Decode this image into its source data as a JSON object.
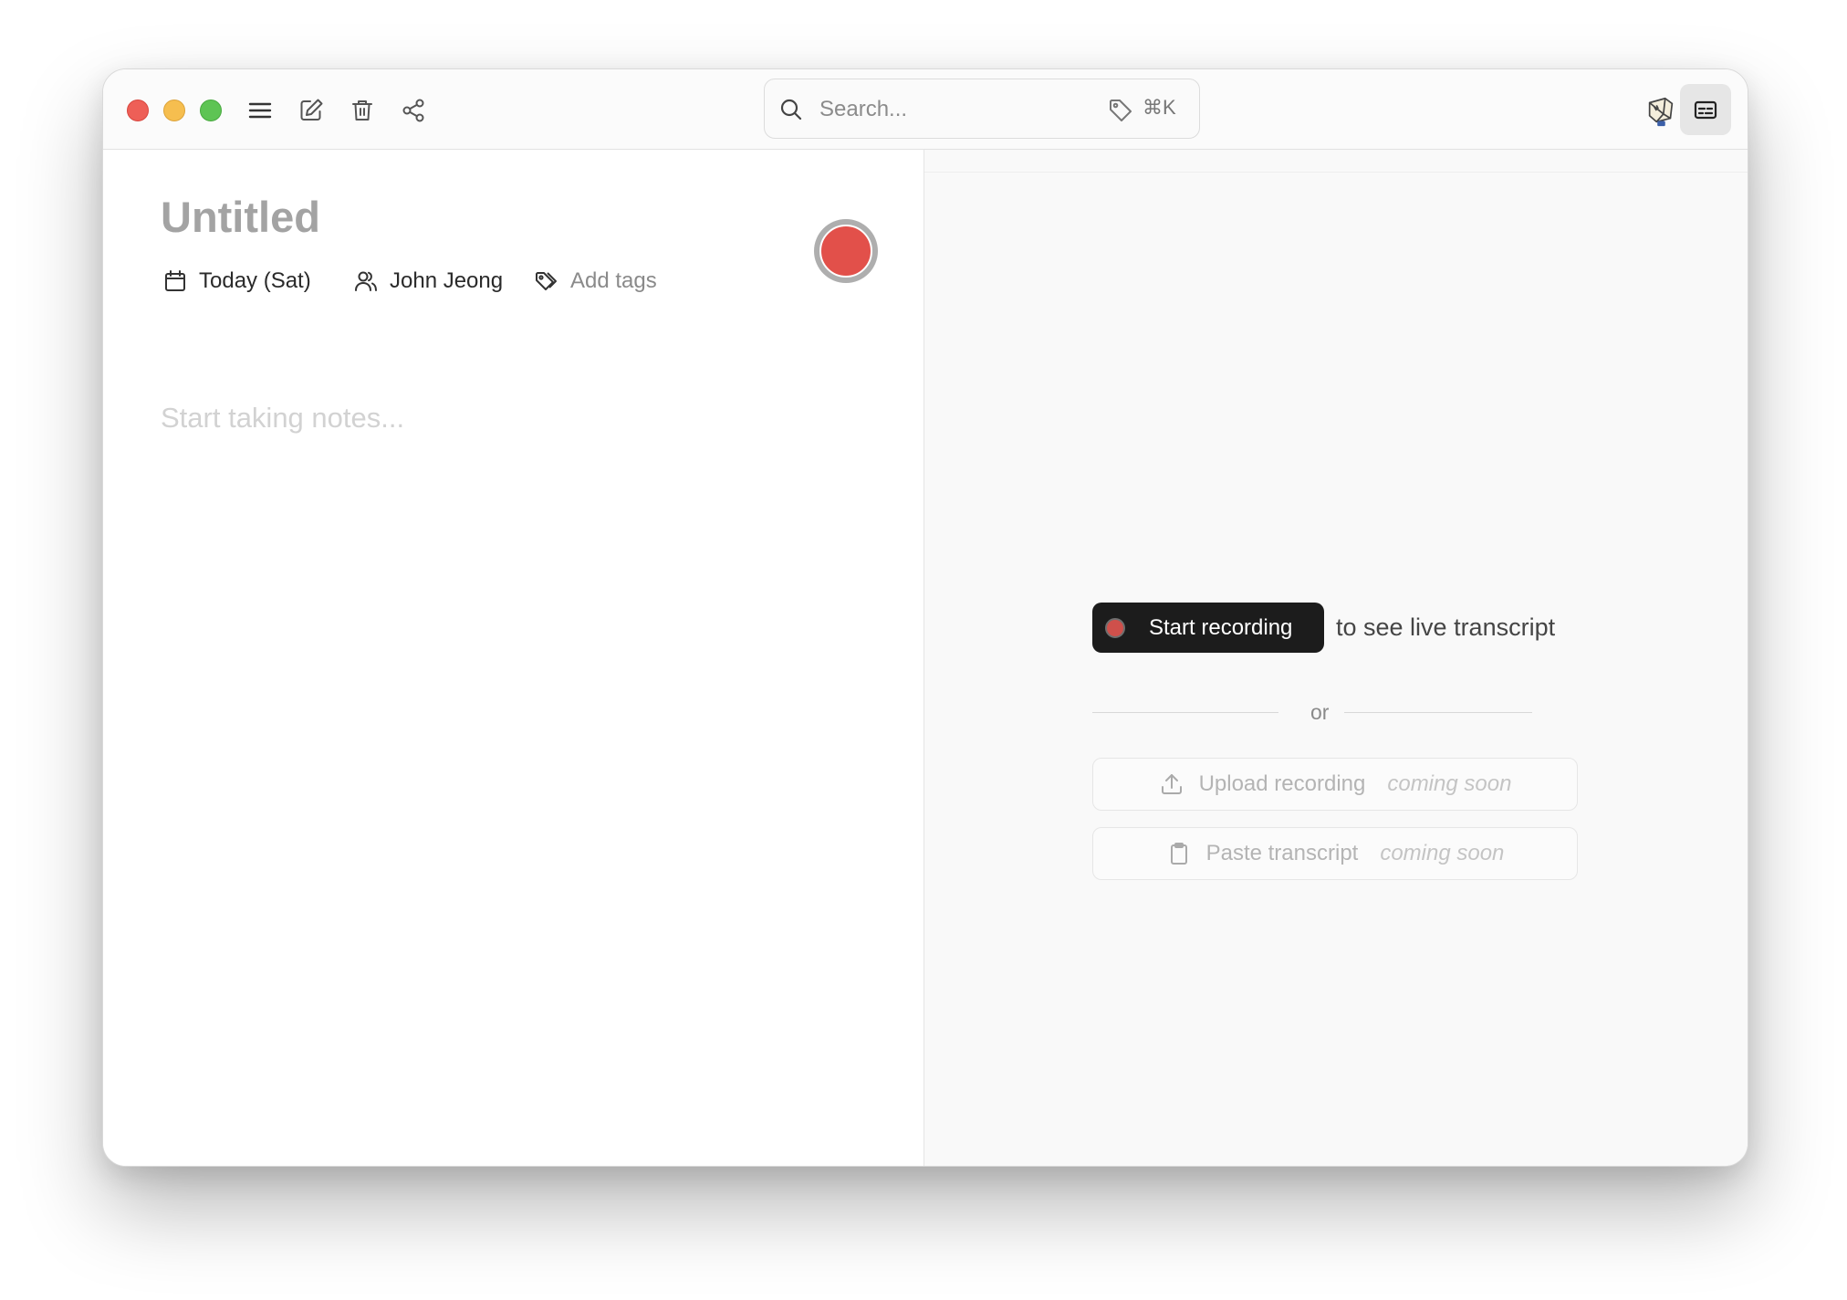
{
  "toolbar": {
    "menu_icon": "hamburger-menu-icon",
    "new_note_icon": "compose-icon",
    "delete_icon": "trash-icon",
    "share_icon": "share-icon"
  },
  "search": {
    "placeholder": "Search...",
    "shortcut": "⌘K"
  },
  "note": {
    "title": "Untitled",
    "date": "Today (Sat)",
    "author": "John Jeong",
    "tags_placeholder": "Add tags",
    "body_placeholder": "Start taking notes..."
  },
  "transcript": {
    "start_button": "Start recording",
    "live_text": "to see live transcript",
    "or": "or",
    "upload_label": "Upload recording",
    "upload_soon": "coming soon",
    "paste_label": "Paste transcript",
    "paste_soon": "coming soon"
  },
  "colors": {
    "record_red": "#e2504a",
    "dark_button": "#1c1c1c"
  }
}
